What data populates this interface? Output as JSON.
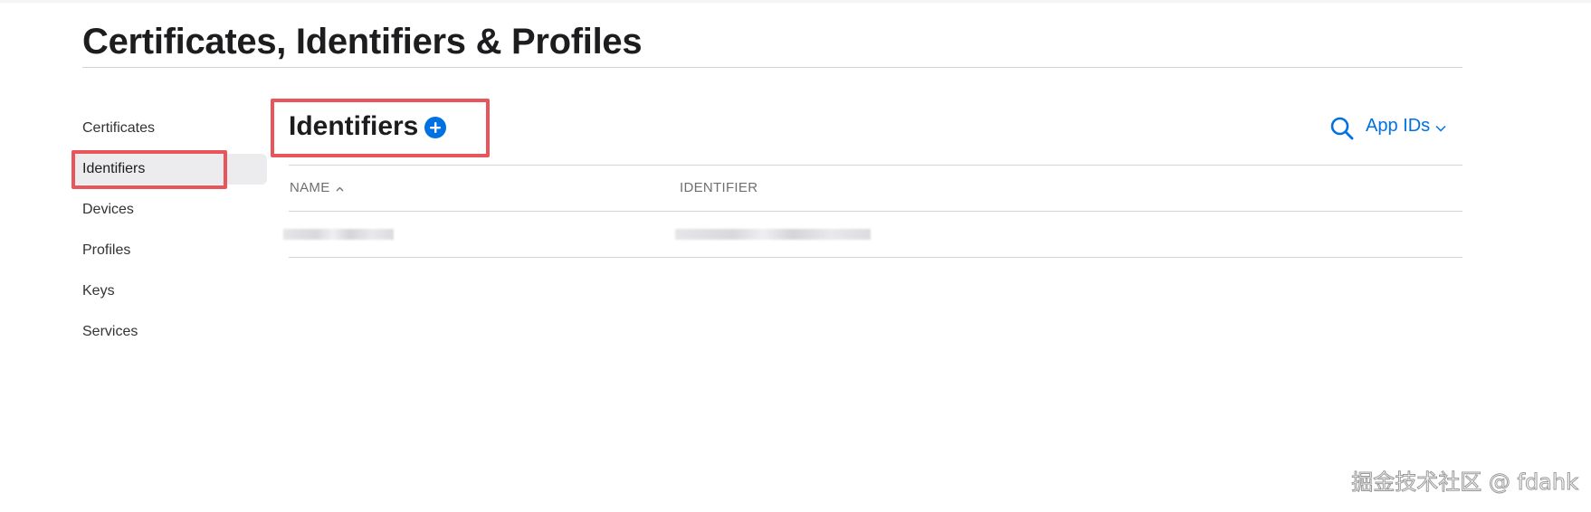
{
  "page": {
    "title": "Certificates, Identifiers & Profiles"
  },
  "sidebar": {
    "items": [
      {
        "label": "Certificates",
        "active": false
      },
      {
        "label": "Identifiers",
        "active": true
      },
      {
        "label": "Devices",
        "active": false
      },
      {
        "label": "Profiles",
        "active": false
      },
      {
        "label": "Keys",
        "active": false
      },
      {
        "label": "Services",
        "active": false
      }
    ]
  },
  "main": {
    "section_title": "Identifiers",
    "add_icon": "plus-circle-icon",
    "search_icon": "search-icon",
    "filter": {
      "selected": "App IDs",
      "icon": "chevron-down-icon"
    },
    "table": {
      "columns": [
        {
          "label": "NAME",
          "sort": "ascending",
          "sort_icon": "chevron-up-icon"
        },
        {
          "label": "IDENTIFIER"
        }
      ],
      "rows": [
        {
          "name": "redacted",
          "identifier": "redacted"
        }
      ]
    }
  },
  "watermark": {
    "text": "掘金技术社区 @ fdahk"
  },
  "colors": {
    "accent": "#0071e3",
    "highlight": "#e8555b",
    "active_item_bg": "#ececee",
    "divider": "#d2d2d7"
  }
}
